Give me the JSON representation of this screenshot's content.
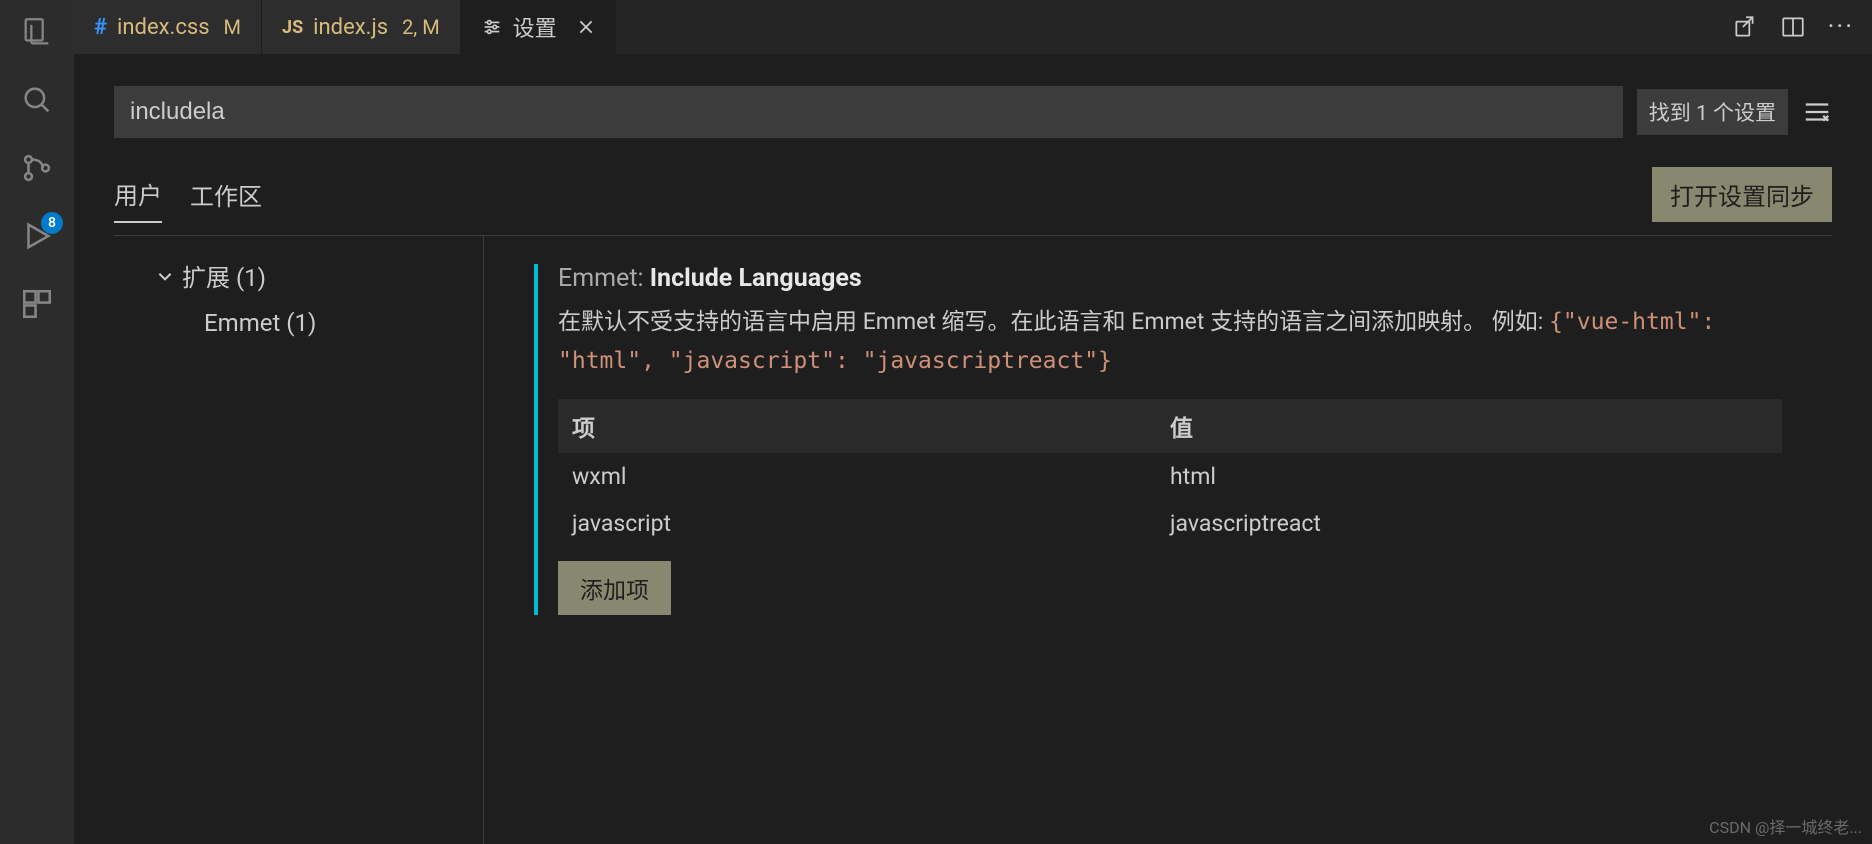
{
  "activity": {
    "scm_badge": "8"
  },
  "tabs": [
    {
      "icon": "css",
      "label": "index.css",
      "status": "M"
    },
    {
      "icon": "js",
      "label": "index.js",
      "status": "2, M"
    },
    {
      "icon": "settings",
      "label": "设置",
      "active": true,
      "closable": true
    }
  ],
  "search": {
    "value": "includela",
    "found_label": "找到 1 个设置"
  },
  "scope": {
    "user": "用户",
    "workspace": "工作区",
    "sync_button": "打开设置同步"
  },
  "tree": {
    "extensions": "扩展 (1)",
    "emmet": "Emmet (1)"
  },
  "setting": {
    "prefix": "Emmet: ",
    "name": "Include Languages",
    "desc_pre": "在默认不受支持的语言中启用 Emmet 缩写。在此语言和 Emmet 支持的语言之间添加映射。 例如: ",
    "desc_code": "{\"vue-html\": \"html\", \"javascript\": \"javascriptreact\"}",
    "col_key": "项",
    "col_val": "值",
    "rows": [
      {
        "k": "wxml",
        "v": "html"
      },
      {
        "k": "javascript",
        "v": "javascriptreact"
      }
    ],
    "add_button": "添加项"
  },
  "watermark": "CSDN @择一城终老..."
}
